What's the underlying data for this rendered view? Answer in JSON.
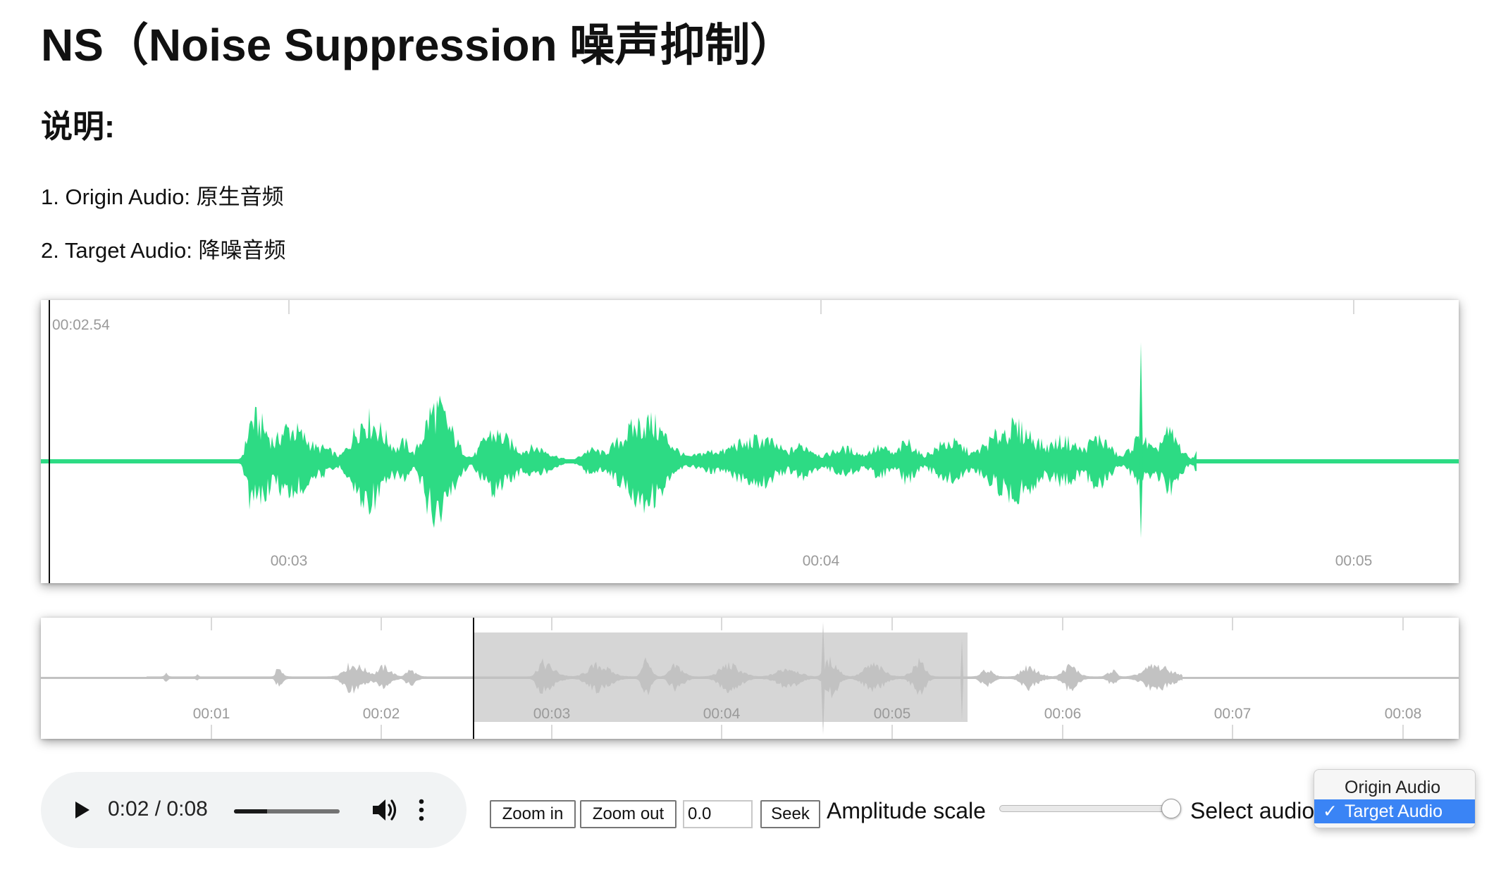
{
  "page": {
    "title": "NS（Noise Suppression 噪声抑制）",
    "subtitle": "说明:",
    "notes": [
      "1. Origin Audio: 原生音频",
      "2. Target Audio: 降噪音频"
    ]
  },
  "colors": {
    "waveform_active": "#2ddb84",
    "waveform_overview": "#c2c2c2",
    "overview_region": "#d6d6d6",
    "dropdown_highlight": "#3a84f5"
  },
  "main_view": {
    "time_readout": "00:02.54",
    "tick_labels": [
      "00:03",
      "00:04",
      "00:05"
    ]
  },
  "overview": {
    "tick_labels": [
      "00:01",
      "00:02",
      "00:03",
      "00:04",
      "00:05",
      "00:06",
      "00:07",
      "00:08"
    ]
  },
  "player": {
    "current_time": "0:02",
    "separator": "/",
    "duration": "0:08",
    "progress_fraction": 0.31,
    "icons": {
      "play": "play-icon",
      "volume": "volume-icon",
      "more": "more-vertical-icon"
    }
  },
  "controls": {
    "zoom_in_label": "Zoom in",
    "zoom_out_label": "Zoom out",
    "seek_value": "0.0",
    "seek_label": "Seek",
    "amplitude_label": "Amplitude scale",
    "amplitude_fraction": 1.0,
    "select_label": "Select audio",
    "audio_options": [
      "Origin Audio",
      "Target Audio"
    ],
    "selected_option": "Target Audio",
    "check_mark": "✓"
  }
}
